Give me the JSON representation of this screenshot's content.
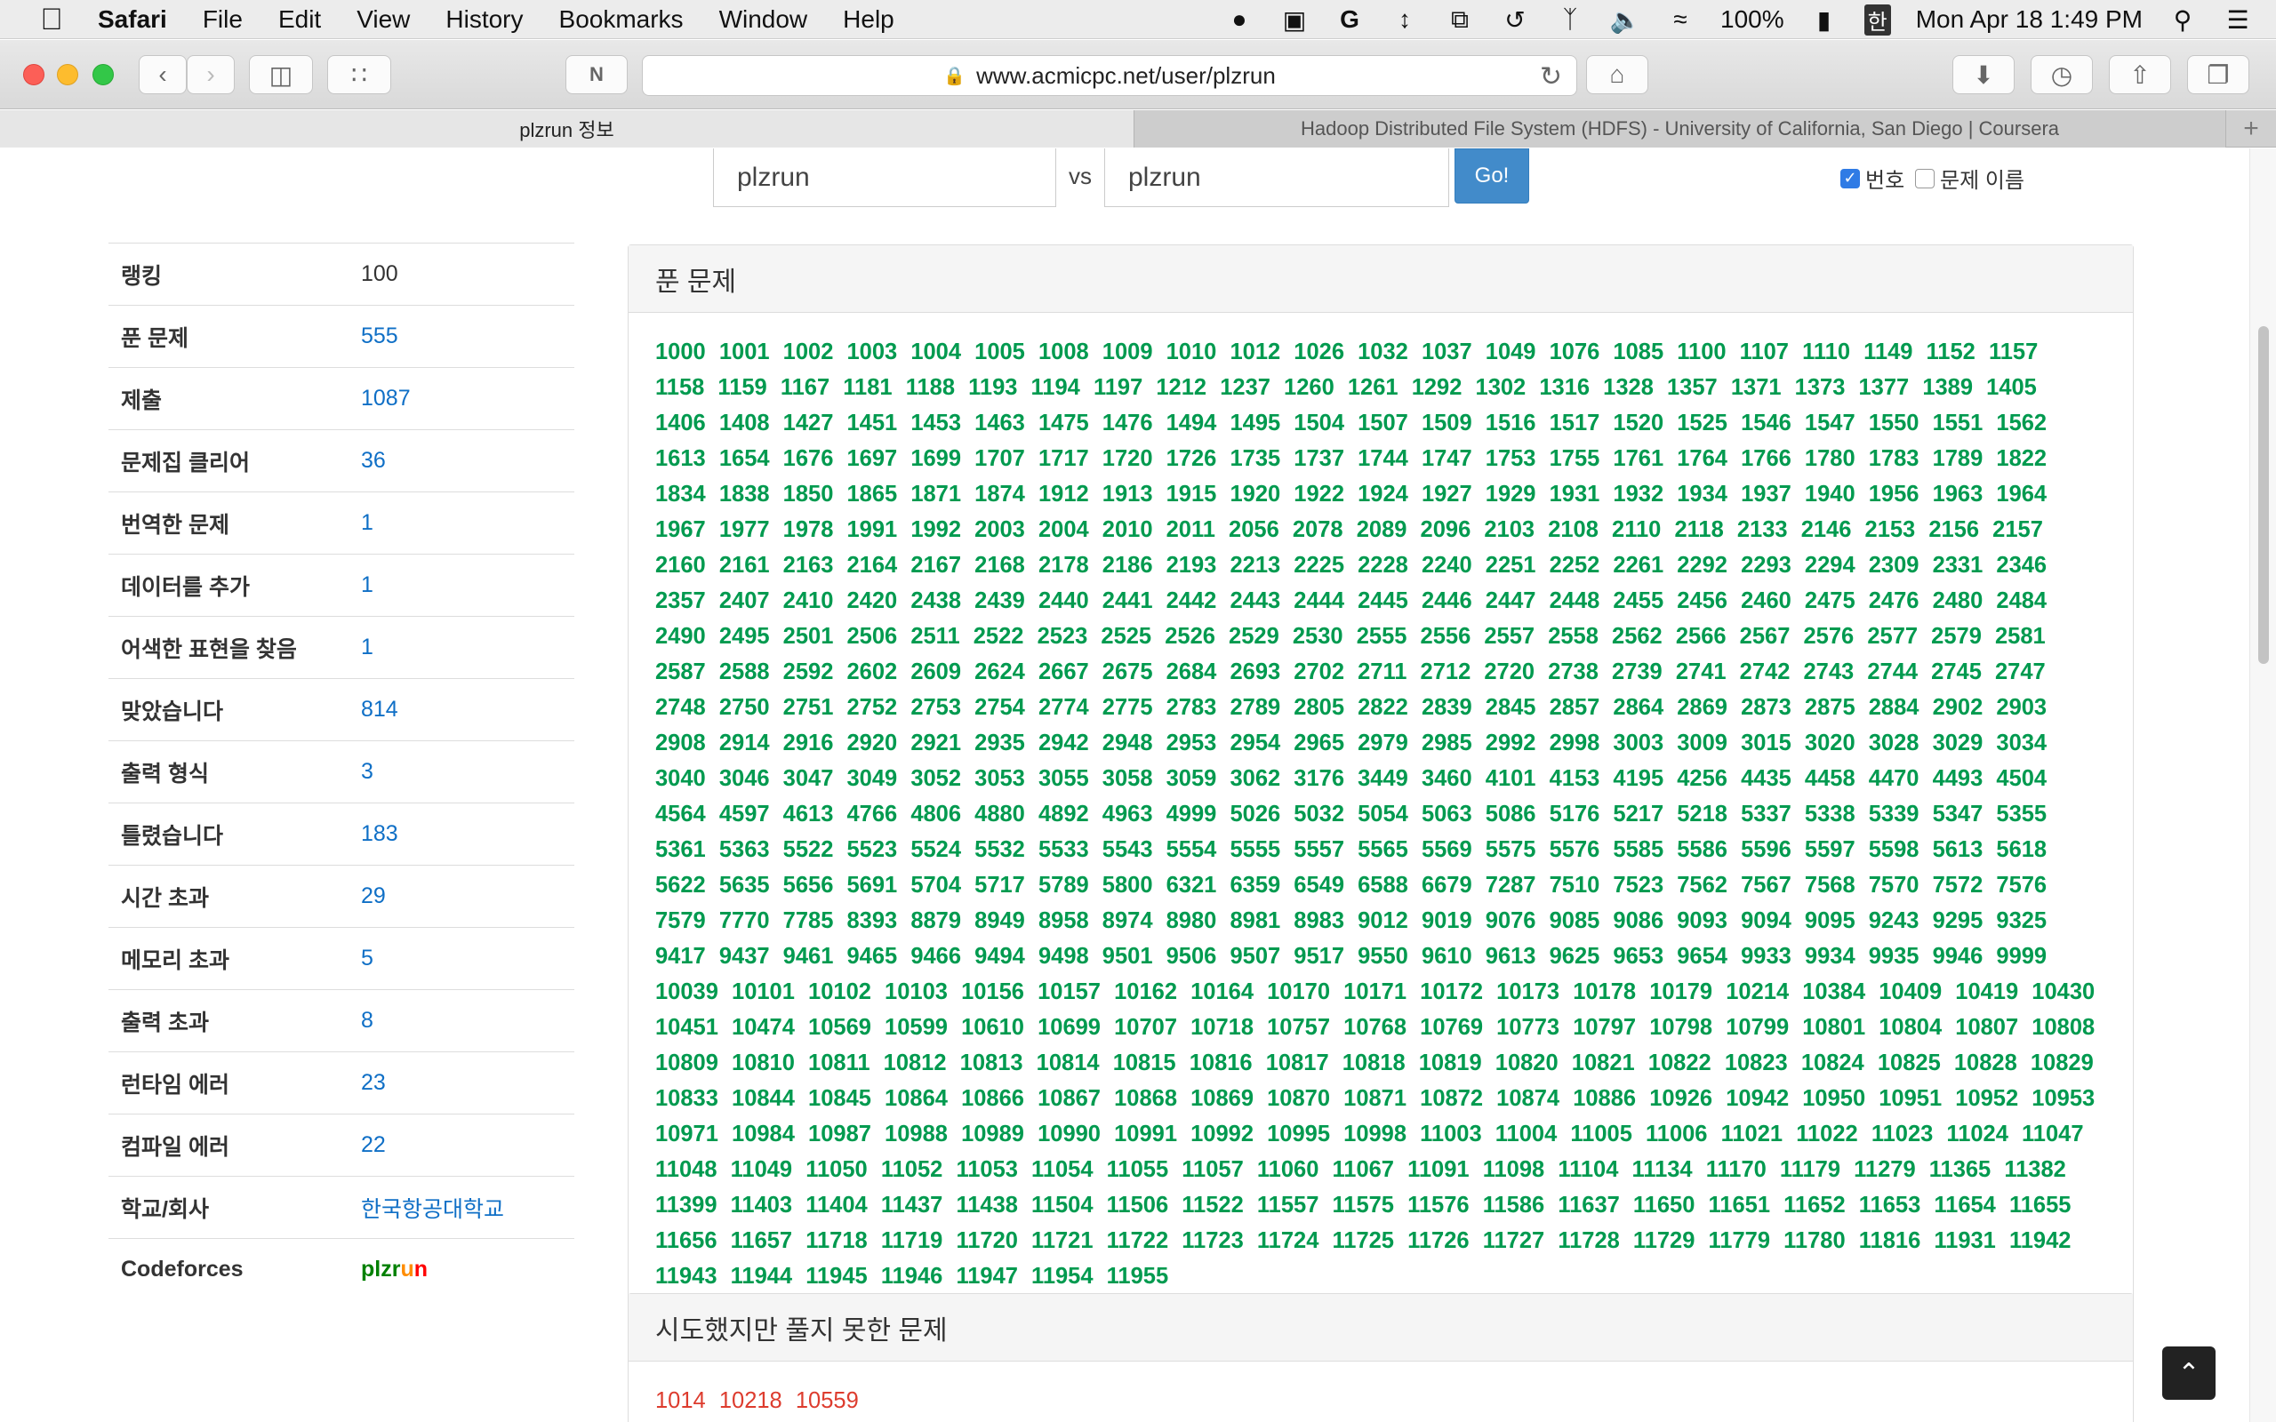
{
  "menubar": {
    "app_name": "Safari",
    "items": [
      "File",
      "Edit",
      "View",
      "History",
      "Bookmarks",
      "Window",
      "Help"
    ],
    "battery": "100%",
    "input_method": "한",
    "clock": "Mon Apr 18  1:49 PM"
  },
  "toolbar": {
    "url": "www.acmicpc.net/user/plzrun"
  },
  "tabs": {
    "active": "plzrun 정보",
    "inactive": "Hadoop Distributed File System (HDFS) - University of California, San Diego | Coursera"
  },
  "compare": {
    "user1": "plzrun",
    "vs": "vs",
    "user2": "plzrun",
    "go": "Go!",
    "opt_number": "번호",
    "opt_title": "문제 이름"
  },
  "stats": [
    {
      "key": "랭킹",
      "value": "100",
      "plain": true
    },
    {
      "key": "푼 문제",
      "value": "555"
    },
    {
      "key": "제출",
      "value": "1087"
    },
    {
      "key": "문제집 클리어",
      "value": "36"
    },
    {
      "key": "번역한 문제",
      "value": "1"
    },
    {
      "key": "데이터를 추가",
      "value": "1"
    },
    {
      "key": "어색한 표현을 찾음",
      "value": "1"
    },
    {
      "key": "맞았습니다",
      "value": "814"
    },
    {
      "key": "출력 형식",
      "value": "3"
    },
    {
      "key": "틀렸습니다",
      "value": "183"
    },
    {
      "key": "시간 초과",
      "value": "29"
    },
    {
      "key": "메모리 초과",
      "value": "5"
    },
    {
      "key": "출력 초과",
      "value": "8"
    },
    {
      "key": "런타임 에러",
      "value": "23"
    },
    {
      "key": "컴파일 에러",
      "value": "22"
    },
    {
      "key": "학교/회사",
      "value": "한국항공대학교"
    }
  ],
  "codeforces": {
    "key": "Codeforces",
    "handle_letters": [
      "p",
      "l",
      "z",
      "r",
      "u",
      "n"
    ],
    "handle_colors": [
      "#008000",
      "#008000",
      "#008000",
      "#008000",
      "#ff8c00",
      "#ff0000"
    ]
  },
  "solved": {
    "title": "푼 문제",
    "problems": [
      "1000",
      "1001",
      "1002",
      "1003",
      "1004",
      "1005",
      "1008",
      "1009",
      "1010",
      "1012",
      "1026",
      "1032",
      "1037",
      "1049",
      "1076",
      "1085",
      "1100",
      "1107",
      "1110",
      "1149",
      "1152",
      "1157",
      "1158",
      "1159",
      "1167",
      "1181",
      "1188",
      "1193",
      "1194",
      "1197",
      "1212",
      "1237",
      "1260",
      "1261",
      "1292",
      "1302",
      "1316",
      "1328",
      "1357",
      "1371",
      "1373",
      "1377",
      "1389",
      "1405",
      "1406",
      "1408",
      "1427",
      "1451",
      "1453",
      "1463",
      "1475",
      "1476",
      "1494",
      "1495",
      "1504",
      "1507",
      "1509",
      "1516",
      "1517",
      "1520",
      "1525",
      "1546",
      "1547",
      "1550",
      "1551",
      "1562",
      "1613",
      "1654",
      "1676",
      "1697",
      "1699",
      "1707",
      "1717",
      "1720",
      "1726",
      "1735",
      "1737",
      "1744",
      "1747",
      "1753",
      "1755",
      "1761",
      "1764",
      "1766",
      "1780",
      "1783",
      "1789",
      "1822",
      "1834",
      "1838",
      "1850",
      "1865",
      "1871",
      "1874",
      "1912",
      "1913",
      "1915",
      "1920",
      "1922",
      "1924",
      "1927",
      "1929",
      "1931",
      "1932",
      "1934",
      "1937",
      "1940",
      "1956",
      "1963",
      "1964",
      "1967",
      "1977",
      "1978",
      "1991",
      "1992",
      "2003",
      "2004",
      "2010",
      "2011",
      "2056",
      "2078",
      "2089",
      "2096",
      "2103",
      "2108",
      "2110",
      "2118",
      "2133",
      "2146",
      "2153",
      "2156",
      "2157",
      "2160",
      "2161",
      "2163",
      "2164",
      "2167",
      "2168",
      "2178",
      "2186",
      "2193",
      "2213",
      "2225",
      "2228",
      "2240",
      "2251",
      "2252",
      "2261",
      "2292",
      "2293",
      "2294",
      "2309",
      "2331",
      "2346",
      "2357",
      "2407",
      "2410",
      "2420",
      "2438",
      "2439",
      "2440",
      "2441",
      "2442",
      "2443",
      "2444",
      "2445",
      "2446",
      "2447",
      "2448",
      "2455",
      "2456",
      "2460",
      "2475",
      "2476",
      "2480",
      "2484",
      "2490",
      "2495",
      "2501",
      "2506",
      "2511",
      "2522",
      "2523",
      "2525",
      "2526",
      "2529",
      "2530",
      "2555",
      "2556",
      "2557",
      "2558",
      "2562",
      "2566",
      "2567",
      "2576",
      "2577",
      "2579",
      "2581",
      "2587",
      "2588",
      "2592",
      "2602",
      "2609",
      "2624",
      "2667",
      "2675",
      "2684",
      "2693",
      "2702",
      "2711",
      "2712",
      "2720",
      "2738",
      "2739",
      "2741",
      "2742",
      "2743",
      "2744",
      "2745",
      "2747",
      "2748",
      "2750",
      "2751",
      "2752",
      "2753",
      "2754",
      "2774",
      "2775",
      "2783",
      "2789",
      "2805",
      "2822",
      "2839",
      "2845",
      "2857",
      "2864",
      "2869",
      "2873",
      "2875",
      "2884",
      "2902",
      "2903",
      "2908",
      "2914",
      "2916",
      "2920",
      "2921",
      "2935",
      "2942",
      "2948",
      "2953",
      "2954",
      "2965",
      "2979",
      "2985",
      "2992",
      "2998",
      "3003",
      "3009",
      "3015",
      "3020",
      "3028",
      "3029",
      "3034",
      "3040",
      "3046",
      "3047",
      "3049",
      "3052",
      "3053",
      "3055",
      "3058",
      "3059",
      "3062",
      "3176",
      "3449",
      "3460",
      "4101",
      "4153",
      "4195",
      "4256",
      "4435",
      "4458",
      "4470",
      "4493",
      "4504",
      "4564",
      "4597",
      "4613",
      "4766",
      "4806",
      "4880",
      "4892",
      "4963",
      "4999",
      "5026",
      "5032",
      "5054",
      "5063",
      "5086",
      "5176",
      "5217",
      "5218",
      "5337",
      "5338",
      "5339",
      "5347",
      "5355",
      "5361",
      "5363",
      "5522",
      "5523",
      "5524",
      "5532",
      "5533",
      "5543",
      "5554",
      "5555",
      "5557",
      "5565",
      "5569",
      "5575",
      "5576",
      "5585",
      "5586",
      "5596",
      "5597",
      "5598",
      "5613",
      "5618",
      "5622",
      "5635",
      "5656",
      "5691",
      "5704",
      "5717",
      "5789",
      "5800",
      "6321",
      "6359",
      "6549",
      "6588",
      "6679",
      "7287",
      "7510",
      "7523",
      "7562",
      "7567",
      "7568",
      "7570",
      "7572",
      "7576",
      "7579",
      "7770",
      "7785",
      "8393",
      "8879",
      "8949",
      "8958",
      "8974",
      "8980",
      "8981",
      "8983",
      "9012",
      "9019",
      "9076",
      "9085",
      "9086",
      "9093",
      "9094",
      "9095",
      "9243",
      "9295",
      "9325",
      "9417",
      "9437",
      "9461",
      "9465",
      "9466",
      "9494",
      "9498",
      "9501",
      "9506",
      "9507",
      "9517",
      "9550",
      "9610",
      "9613",
      "9625",
      "9653",
      "9654",
      "9933",
      "9934",
      "9935",
      "9946",
      "9999",
      "10039",
      "10101",
      "10102",
      "10103",
      "10156",
      "10157",
      "10162",
      "10164",
      "10170",
      "10171",
      "10172",
      "10173",
      "10178",
      "10179",
      "10214",
      "10384",
      "10409",
      "10419",
      "10430",
      "10451",
      "10474",
      "10569",
      "10599",
      "10610",
      "10699",
      "10707",
      "10718",
      "10757",
      "10768",
      "10769",
      "10773",
      "10797",
      "10798",
      "10799",
      "10801",
      "10804",
      "10807",
      "10808",
      "10809",
      "10810",
      "10811",
      "10812",
      "10813",
      "10814",
      "10815",
      "10816",
      "10817",
      "10818",
      "10819",
      "10820",
      "10821",
      "10822",
      "10823",
      "10824",
      "10825",
      "10828",
      "10829",
      "10833",
      "10844",
      "10845",
      "10864",
      "10866",
      "10867",
      "10868",
      "10869",
      "10870",
      "10871",
      "10872",
      "10874",
      "10886",
      "10926",
      "10942",
      "10950",
      "10951",
      "10952",
      "10953",
      "10971",
      "10984",
      "10987",
      "10988",
      "10989",
      "10990",
      "10991",
      "10992",
      "10995",
      "10998",
      "11003",
      "11004",
      "11005",
      "11006",
      "11021",
      "11022",
      "11023",
      "11024",
      "11047",
      "11048",
      "11049",
      "11050",
      "11052",
      "11053",
      "11054",
      "11055",
      "11057",
      "11060",
      "11067",
      "11091",
      "11098",
      "11104",
      "11134",
      "11170",
      "11179",
      "11279",
      "11365",
      "11382",
      "11399",
      "11403",
      "11404",
      "11437",
      "11438",
      "11504",
      "11506",
      "11522",
      "11557",
      "11575",
      "11576",
      "11586",
      "11637",
      "11650",
      "11651",
      "11652",
      "11653",
      "11654",
      "11655",
      "11656",
      "11657",
      "11718",
      "11719",
      "11720",
      "11721",
      "11722",
      "11723",
      "11724",
      "11725",
      "11726",
      "11727",
      "11728",
      "11729",
      "11779",
      "11780",
      "11816",
      "11931",
      "11942",
      "11943",
      "11944",
      "11945",
      "11946",
      "11947",
      "11954",
      "11955"
    ]
  },
  "failed": {
    "title": "시도했지만 풀지 못한 문제",
    "problems": [
      "1014",
      "10218",
      "10559"
    ]
  }
}
